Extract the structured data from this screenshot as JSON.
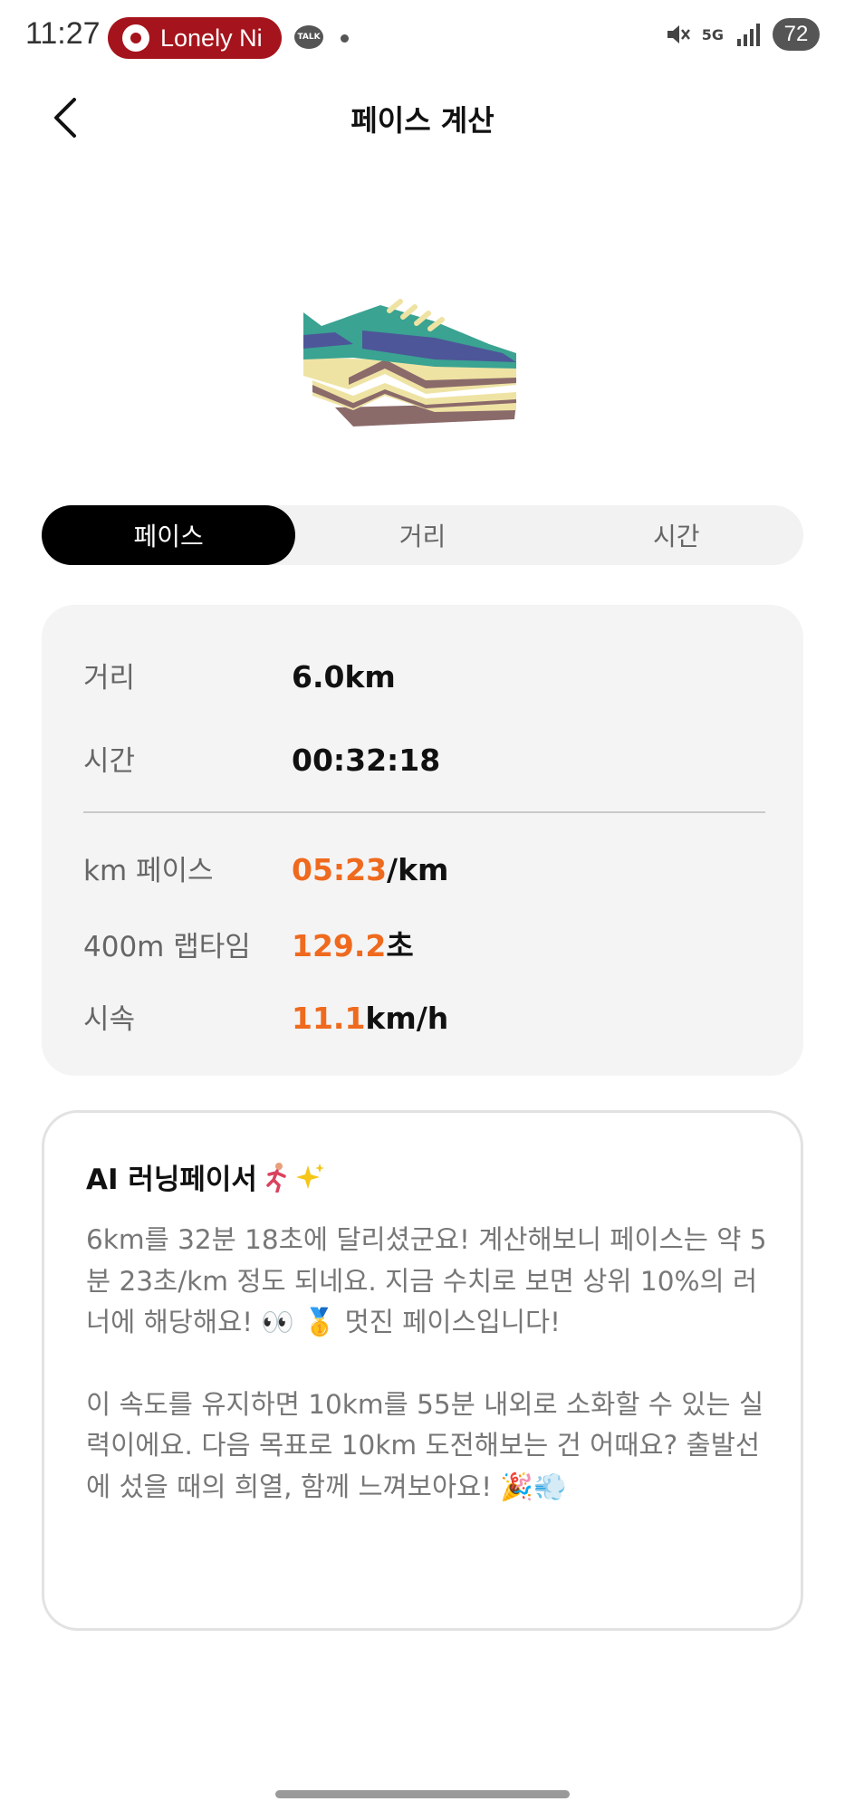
{
  "status_bar": {
    "time": "11:27",
    "media_pill": "Lonely Ni",
    "talk_badge": "TALK",
    "battery": "72",
    "network": "5G"
  },
  "header": {
    "title": "페이스 계산"
  },
  "tabs": [
    {
      "label": "페이스",
      "active": true
    },
    {
      "label": "거리",
      "active": false
    },
    {
      "label": "시간",
      "active": false
    }
  ],
  "inputs": {
    "distance_label": "거리",
    "distance_value": "6.0km",
    "time_label": "시간",
    "time_value": "00:32:18"
  },
  "results": {
    "km_pace_label": "km 페이스",
    "km_pace_value": "05:23",
    "km_pace_unit": "/km",
    "lap_label": "400m 랩타임",
    "lap_value": "129.2",
    "lap_unit": "초",
    "speed_label": "시속",
    "speed_value": "11.1",
    "speed_unit": "km/h"
  },
  "ai_pacer": {
    "title": "AI 러닝페이서",
    "paragraph1": "6km를 32분 18초에 달리셨군요! 계산해보니 페이스는 약 5분 23초/km 정도 되네요. 지금 수치로 보면 상위 10%의 러너에 해당해요! 👀 🥇 멋진 페이스입니다!",
    "paragraph2": "이 속도를 유지하면 10km를 55분 내외로 소화할 수 있는 실력이에요. 다음 목표로 10km 도전해보는 건 어때요? 출발선에 섰을 때의 희열, 함께 느껴보아요! 🎉💨"
  },
  "colors": {
    "accent": "#ef6a1e",
    "tab_active_bg": "#000000",
    "card_bg": "#f4f4f4"
  }
}
